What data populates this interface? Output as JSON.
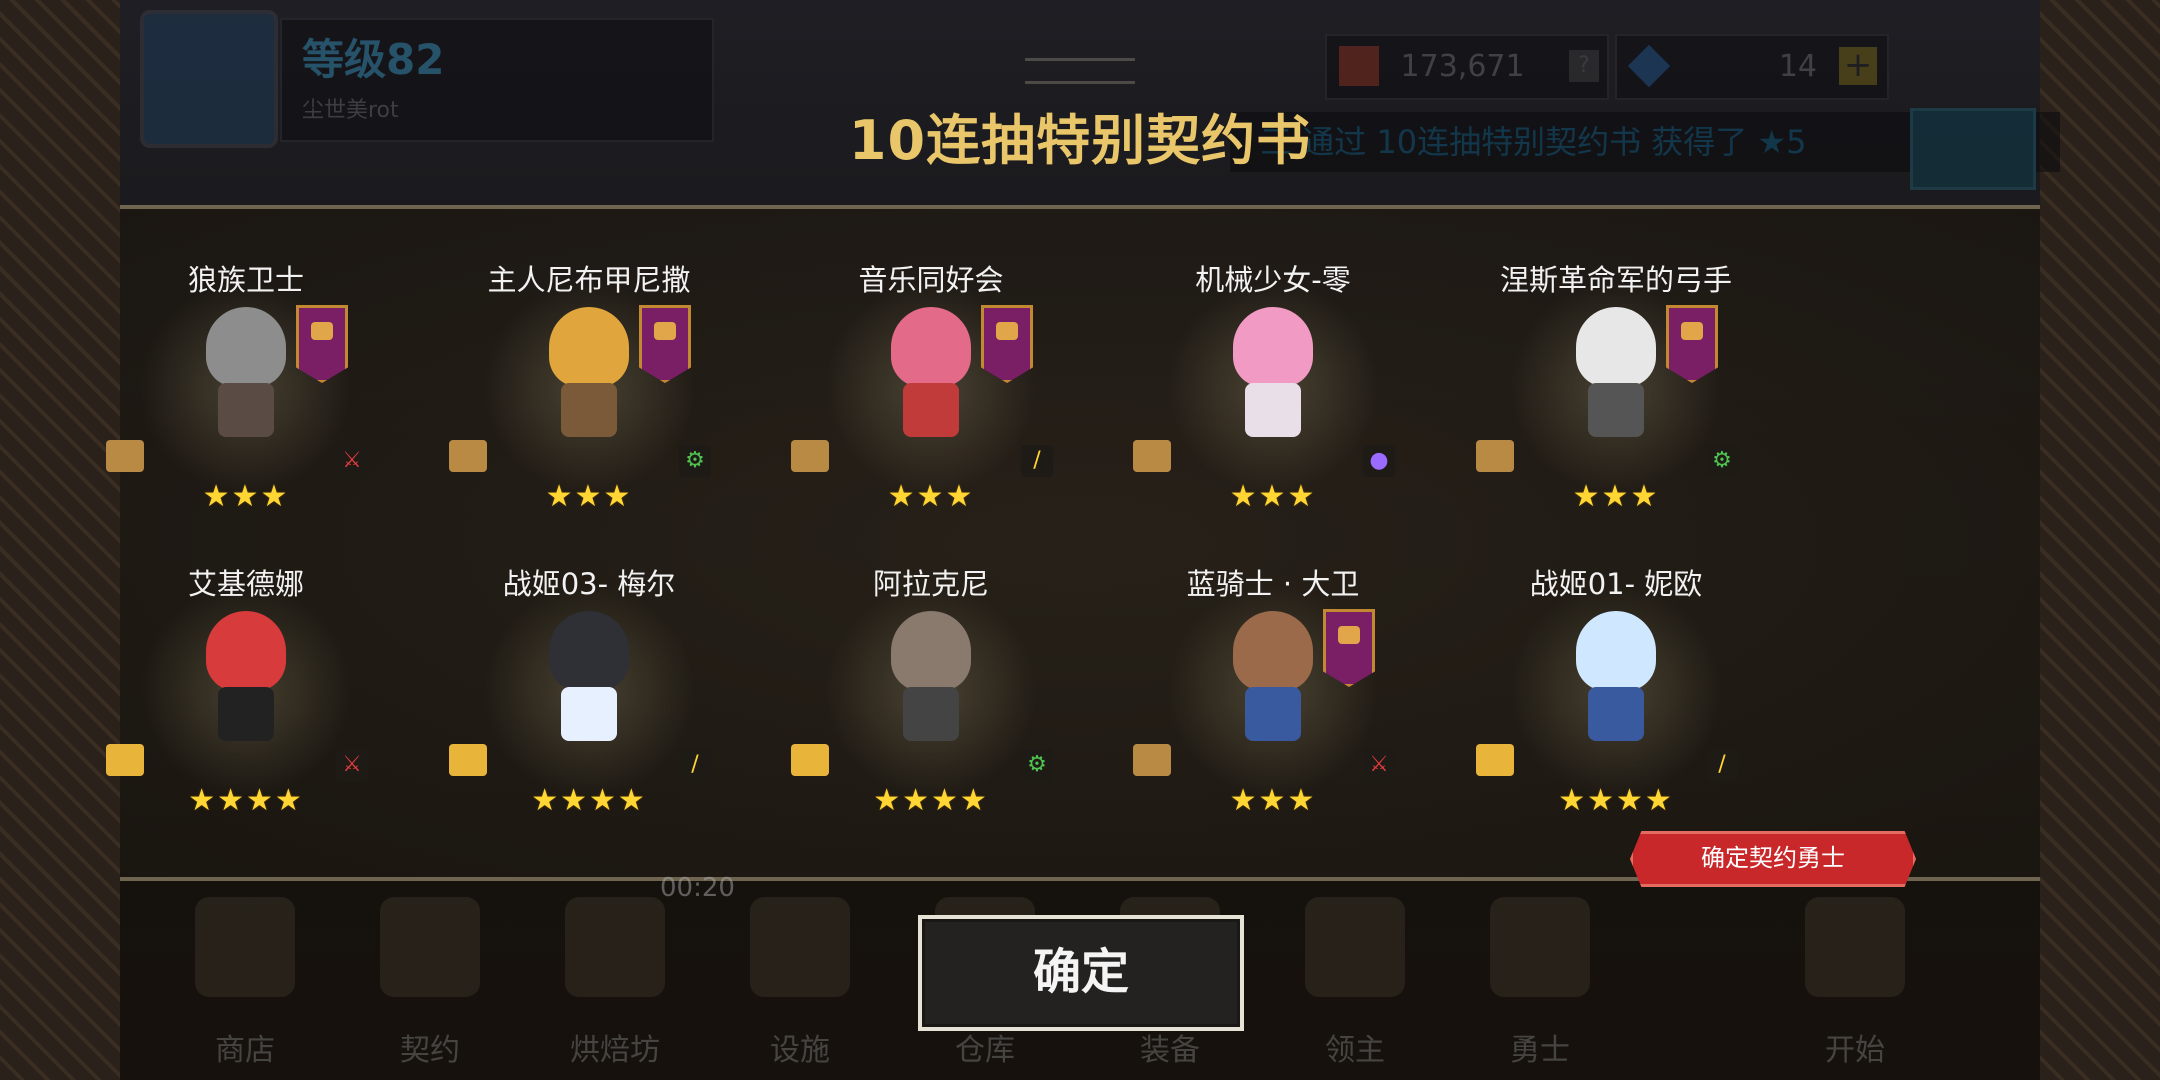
{
  "header": {
    "player_level": "等级82",
    "player_name": "尘世美rot",
    "gold": "173,671",
    "gold_help": "?",
    "gems": "14",
    "gems_plus": "+",
    "ticker": "三 通过 10连抽特别契约书 获得了 ★5"
  },
  "dialog": {
    "title": "10连抽特别契约书",
    "confirm_button": "确定",
    "guaranteed_label": "确定契约勇士"
  },
  "results": [
    {
      "name": "狼族卫士",
      "stars": "★★★",
      "scroll": "bronze",
      "weapon": "sword-icon",
      "banner": true
    },
    {
      "name": "主人尼布甲尼撒",
      "stars": "★★★",
      "scroll": "bronze",
      "weapon": "gear-icon",
      "banner": true
    },
    {
      "name": "音乐同好会",
      "stars": "★★★",
      "scroll": "bronze",
      "weapon": "staff-icon",
      "banner": true
    },
    {
      "name": "机械少女-零",
      "stars": "★★★",
      "scroll": "bronze",
      "weapon": "orb-icon",
      "banner": false
    },
    {
      "name": "涅斯革命军的弓手",
      "stars": "★★★",
      "scroll": "bronze",
      "weapon": "gear-icon",
      "banner": true
    },
    {
      "name": "艾基德娜",
      "stars": "★★★★",
      "scroll": "gold",
      "weapon": "sword-icon",
      "banner": false
    },
    {
      "name": "战姬03- 梅尔",
      "stars": "★★★★",
      "scroll": "gold",
      "weapon": "staff-icon",
      "banner": false
    },
    {
      "name": "阿拉克尼",
      "stars": "★★★★",
      "scroll": "gold",
      "weapon": "gear-icon",
      "banner": false
    },
    {
      "name": "蓝骑士 · 大卫",
      "stars": "★★★",
      "scroll": "bronze",
      "weapon": "sword-icon",
      "banner": true
    },
    {
      "name": "战姬01- 妮欧",
      "stars": "★★★★",
      "scroll": "gold",
      "weapon": "staff-icon",
      "banner": false
    }
  ],
  "bottom_nav": {
    "timer": "00:20",
    "items": [
      "商店",
      "契约",
      "烘焙坊",
      "设施",
      "仓库",
      "装备",
      "领主",
      "勇士",
      "开始"
    ]
  },
  "colors": {
    "title": "#e9c66a",
    "star": "#ffd633",
    "ribbon": "#c9282a",
    "banner": "#7a1f66"
  }
}
